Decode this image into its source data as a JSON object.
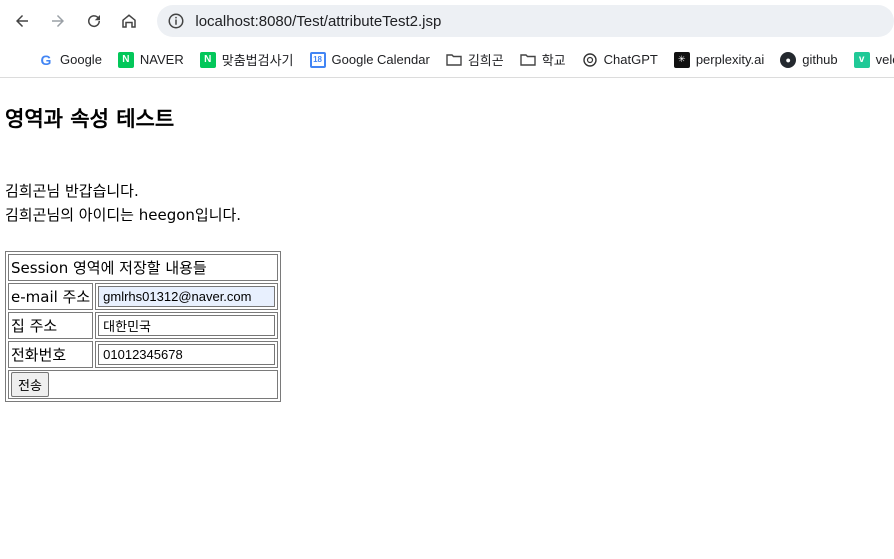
{
  "browser": {
    "url": "localhost:8080/Test/attributeTest2.jsp",
    "bookmarks": [
      {
        "label": "Google",
        "icon": "google-icon",
        "color": "#4285f4"
      },
      {
        "label": "NAVER",
        "icon": "naver-icon",
        "color": "#03c75a"
      },
      {
        "label": "맞춤법검사기",
        "icon": "naver-icon",
        "color": "#03c75a"
      },
      {
        "label": "Google Calendar",
        "icon": "calendar-icon",
        "color": "#4285f4"
      },
      {
        "label": "김희곤",
        "icon": "folder-icon",
        "color": "#5f6368"
      },
      {
        "label": "학교",
        "icon": "folder-icon",
        "color": "#5f6368"
      },
      {
        "label": "ChatGPT",
        "icon": "chatgpt-icon",
        "color": "#202124"
      },
      {
        "label": "perplexity.ai",
        "icon": "perplexity-icon",
        "color": "#202124"
      },
      {
        "label": "github",
        "icon": "github-icon",
        "color": "#202124"
      },
      {
        "label": "velo",
        "icon": "velog-icon",
        "color": "#20c997"
      }
    ]
  },
  "page": {
    "heading": "영역과 속성 테스트",
    "greeting": "김희곤님 반갑습니다.",
    "id_line": "김희곤님의 아이디는 heegon입니다.",
    "table": {
      "caption": "Session 영역에 저장할 내용들",
      "rows": [
        {
          "label": "e-mail 주소",
          "value": "gmlrhs01312@naver.com"
        },
        {
          "label": "집 주소",
          "value": "대한민국"
        },
        {
          "label": "전화번호",
          "value": "01012345678"
        }
      ],
      "submit_label": "전송"
    }
  }
}
